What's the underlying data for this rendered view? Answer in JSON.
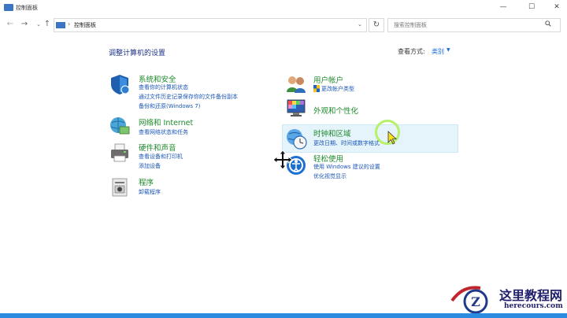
{
  "window": {
    "title": "控制面板",
    "min_glyph": "—",
    "max_glyph": "☐",
    "close_glyph": "✕"
  },
  "nav": {
    "back_glyph": "←",
    "forward_glyph": "→",
    "recent_glyph": "⌄",
    "up_glyph": "↑",
    "address_sep": "›",
    "address_text": "控制面板",
    "address_dropdown_glyph": "⌄",
    "refresh_glyph": "↻",
    "search_placeholder": "搜索控制面板"
  },
  "content": {
    "page_title": "调整计算机的设置",
    "view_by_label": "查看方式:",
    "view_by_value": "类别",
    "view_by_caret": "▼"
  },
  "categories_left": [
    {
      "title": "系统和安全",
      "icon": "shield-icon",
      "links": [
        "查看你的计算机状态",
        "通过文件历史记录保存你的文件备份副本",
        "备份和还原(Windows 7)"
      ]
    },
    {
      "title": "网络和 Internet",
      "icon": "network-icon",
      "links": [
        "查看网络状态和任务"
      ]
    },
    {
      "title": "硬件和声音",
      "icon": "printer-icon",
      "links": [
        "查看设备和打印机",
        "添加设备"
      ]
    },
    {
      "title": "程序",
      "icon": "programs-icon",
      "links": [
        "卸载程序"
      ]
    }
  ],
  "categories_right": [
    {
      "title": "用户帐户",
      "icon": "users-icon",
      "links": [
        "更改帐户类型"
      ]
    },
    {
      "title": "外观和个性化",
      "icon": "appearance-icon",
      "links": []
    },
    {
      "title": "时钟和区域",
      "icon": "clock-globe-icon",
      "links": [
        "更改日期、时间或数字格式"
      ]
    },
    {
      "title": "轻松使用",
      "icon": "ease-of-access-icon",
      "links": [
        "使用 Windows 建议的设置",
        "优化视觉显示"
      ]
    }
  ],
  "watermark": {
    "logo_letter": "Z",
    "title": "这里教程网",
    "url": "herecours.com"
  }
}
